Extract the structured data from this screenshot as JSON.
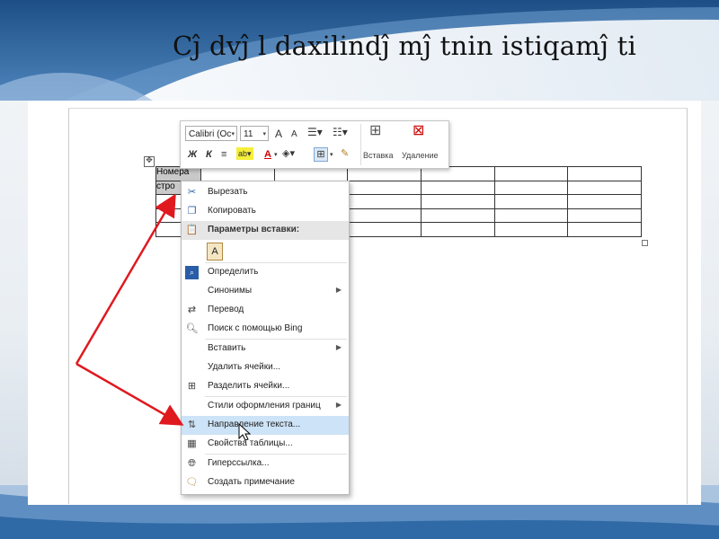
{
  "slide": {
    "title": "Cĵ dvĵ l daxilindĵ  mĵ tnin istiqamĵ ti"
  },
  "document": {
    "table": {
      "rows": [
        [
          "Номера",
          "",
          "",
          "",
          "",
          "",
          ""
        ],
        [
          "стро",
          "",
          "",
          "",
          "",
          "",
          ""
        ],
        [
          "",
          "",
          "",
          "",
          "",
          "",
          ""
        ],
        [
          "",
          "",
          "",
          "",
          "",
          "",
          ""
        ],
        [
          "",
          "",
          "",
          "",
          "",
          "",
          ""
        ]
      ]
    }
  },
  "mini_toolbar": {
    "font_name": "Calibri (Oc",
    "font_size": "11",
    "bold_label": "Ж",
    "italic_label": "К",
    "grow_label": "A",
    "shrink_label": "A",
    "font_color_label": "A",
    "insert_label": "Вставка",
    "delete_label": "Удаление"
  },
  "context_menu": {
    "items": [
      {
        "label": "Вырезать",
        "icon": "scissors-icon"
      },
      {
        "label": "Копировать",
        "icon": "copy-icon"
      },
      {
        "label": "Параметры вставки:",
        "icon": "paste-icon"
      },
      {
        "label": "A",
        "icon": "paste-keep-text-icon"
      },
      {
        "label": "Определить",
        "icon": "search-definition-icon"
      },
      {
        "label": "Синонимы",
        "icon": ""
      },
      {
        "label": "Перевод",
        "icon": "translate-icon"
      },
      {
        "label": "Поиск с помощью Bing",
        "icon": "search-icon"
      },
      {
        "label": "Вставить",
        "icon": ""
      },
      {
        "label": "Удалить ячейки...",
        "icon": ""
      },
      {
        "label": "Разделить ячейки...",
        "icon": "split-cells-icon"
      },
      {
        "label": "Стили оформления границ",
        "icon": ""
      },
      {
        "label": "Направление текста...",
        "icon": "text-direction-icon"
      },
      {
        "label": "Свойства таблицы...",
        "icon": "table-properties-icon"
      },
      {
        "label": "Гиперссылка...",
        "icon": "hyperlink-icon"
      },
      {
        "label": "Создать примечание",
        "icon": "comment-icon"
      }
    ]
  },
  "colors": {
    "arrow": "#e0191f",
    "menu_hover": "#cde3f7",
    "accent": "#2a5da8"
  }
}
